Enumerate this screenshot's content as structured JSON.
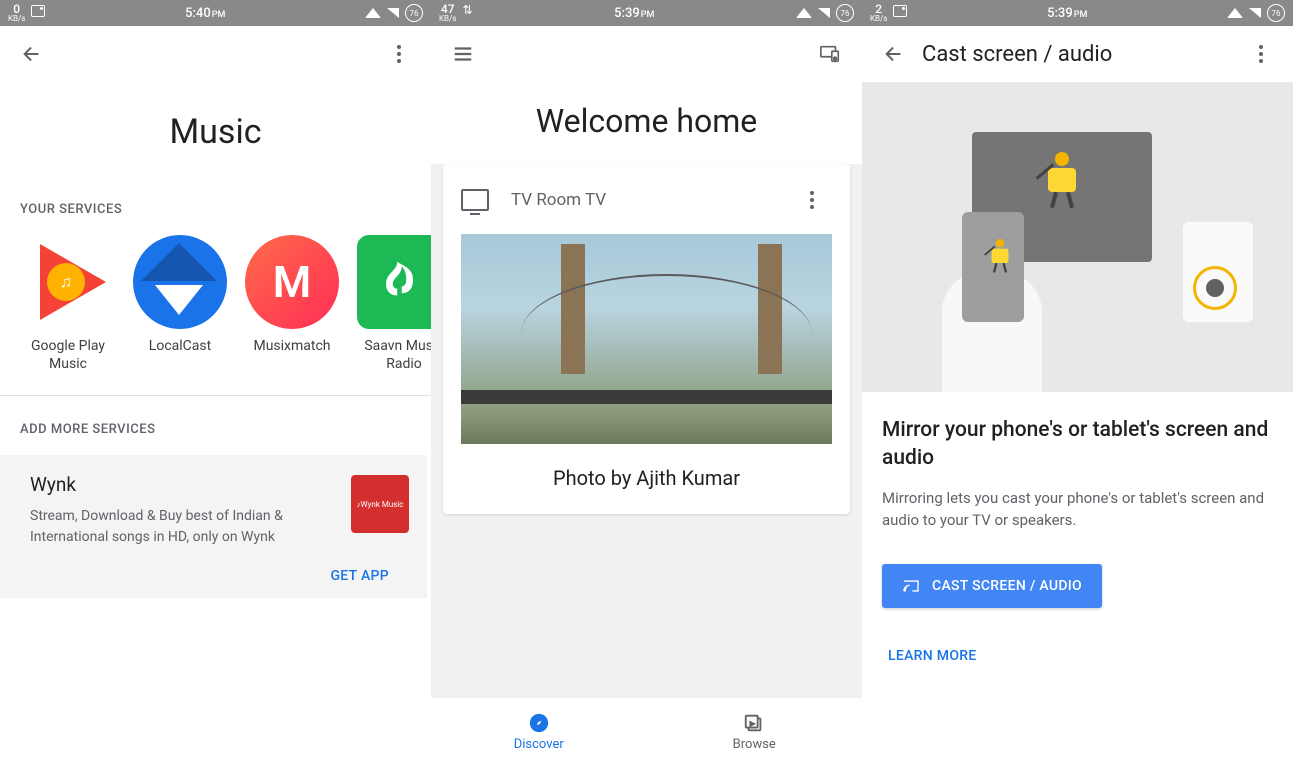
{
  "panel1": {
    "status": {
      "kbs_num": "0",
      "kbs_lbl": "KB/s",
      "time": "5:40",
      "pm": "PM",
      "batt": "76"
    },
    "page_title": "Music",
    "your_services_label": "YOUR SERVICES",
    "services": [
      {
        "label": "Google Play Music"
      },
      {
        "label": "LocalCast"
      },
      {
        "label": "Musixmatch"
      },
      {
        "label": "Saavn Music Radio"
      }
    ],
    "add_more_label": "ADD MORE SERVICES",
    "more": {
      "title": "Wynk",
      "desc": "Stream, Download & Buy best of Indian & International songs in HD, only on Wynk",
      "logo_label": "Wynk Music",
      "get_app": "GET APP"
    }
  },
  "panel2": {
    "status": {
      "kbs_num": "47",
      "kbs_lbl": "KB/s",
      "time": "5:39",
      "pm": "PM",
      "batt": "76"
    },
    "welcome": "Welcome home",
    "device": {
      "name": "TV Room TV",
      "caption": "Photo by Ajith Kumar"
    },
    "nav": {
      "discover": "Discover",
      "browse": "Browse"
    }
  },
  "panel3": {
    "status": {
      "kbs_num": "2",
      "kbs_lbl": "KB/s",
      "time": "5:39",
      "pm": "PM",
      "batt": "76"
    },
    "title": "Cast screen / audio",
    "heading": "Mirror your phone's or tablet's screen and audio",
    "desc": "Mirroring lets you cast your phone's or tablet's screen and audio to your TV or speakers.",
    "cast_btn": "CAST SCREEN / AUDIO",
    "learn_more": "LEARN MORE"
  }
}
